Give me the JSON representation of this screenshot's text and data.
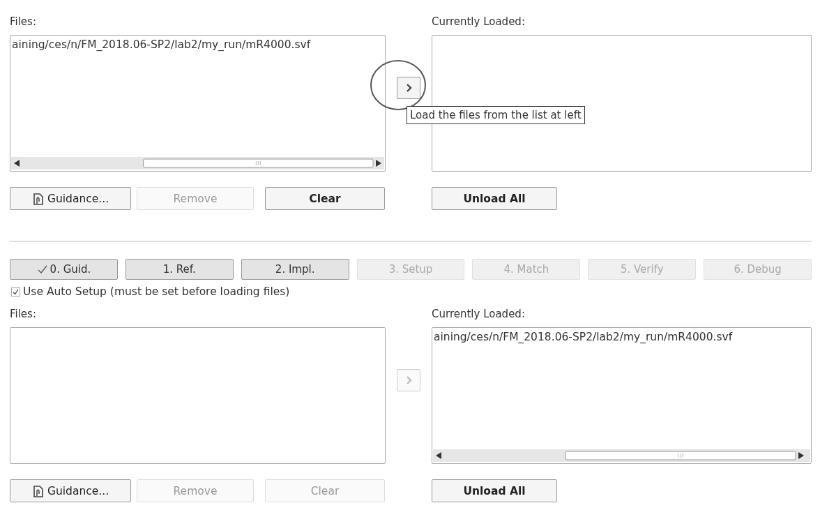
{
  "top_panel": {
    "files": {
      "label": "Files:",
      "items": [
        "aining/ces/n/FM_2018.06-SP2/lab2/my_run/mR4000.svf"
      ]
    },
    "load_button": {
      "disabled": false,
      "highlighted": true,
      "tooltip": "Load the files from the list at left"
    },
    "loaded": {
      "label": "Currently Loaded:"
    },
    "buttons": [
      {
        "label": "Guidance...",
        "kind": "guidance",
        "disabled": false
      },
      {
        "label": "Remove",
        "kind": "plain",
        "disabled": true
      },
      {
        "label": "Clear",
        "kind": "plain",
        "disabled": false
      }
    ],
    "unload_button": {
      "label": "Unload All",
      "disabled": false
    }
  },
  "step_tabs": [
    {
      "label": "0. Guid.",
      "checked": true,
      "disabled": false
    },
    {
      "label": "1. Ref.",
      "checked": false,
      "disabled": false
    },
    {
      "label": "2. Impl.",
      "checked": false,
      "disabled": false
    },
    {
      "label": "3. Setup",
      "checked": false,
      "disabled": true
    },
    {
      "label": "4. Match",
      "checked": false,
      "disabled": true
    },
    {
      "label": "5. Verify",
      "checked": false,
      "disabled": true
    },
    {
      "label": "6. Debug",
      "checked": false,
      "disabled": true
    }
  ],
  "auto_setup": {
    "label": "Use Auto Setup (must be set before loading files)",
    "checked": true
  },
  "bottom_panel": {
    "files": {
      "label": "Files:"
    },
    "load_button": {
      "disabled": true
    },
    "loaded": {
      "label": "Currently Loaded:",
      "items": [
        "aining/ces/n/FM_2018.06-SP2/lab2/my_run/mR4000.svf"
      ]
    },
    "buttons": [
      {
        "label": "Guidance...",
        "kind": "guidance",
        "disabled": false
      },
      {
        "label": "Remove",
        "kind": "plain",
        "disabled": true
      },
      {
        "label": "Clear",
        "kind": "plain",
        "disabled": true
      }
    ],
    "unload_button": {
      "label": "Unload All",
      "disabled": false
    }
  }
}
